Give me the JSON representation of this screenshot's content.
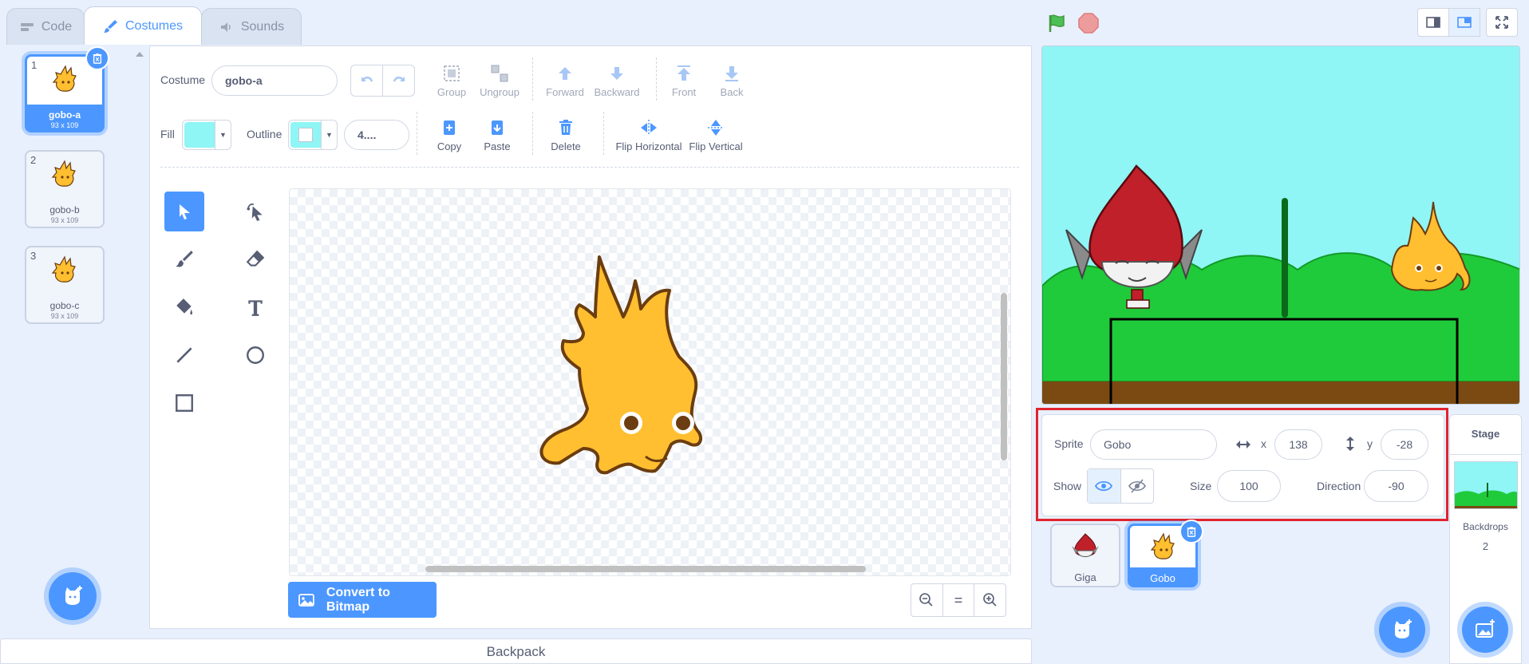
{
  "tabs": [
    {
      "label": "Code",
      "icon": "code-icon"
    },
    {
      "label": "Costumes",
      "icon": "brush-icon"
    },
    {
      "label": "Sounds",
      "icon": "speaker-icon"
    }
  ],
  "costumes": [
    {
      "num": "1",
      "name": "gobo-a",
      "size": "93 x 109",
      "selected": true
    },
    {
      "num": "2",
      "name": "gobo-b",
      "size": "93 x 109",
      "selected": false
    },
    {
      "num": "3",
      "name": "gobo-c",
      "size": "93 x 109",
      "selected": false
    }
  ],
  "editor": {
    "costume_label": "Costume",
    "costume_name": "gobo-a",
    "fill_label": "Fill",
    "outline_label": "Outline",
    "outline_width": "4....",
    "fill_color": "#8ff5f5",
    "buttons_row1": {
      "group": "Group",
      "ungroup": "Ungroup",
      "forward": "Forward",
      "backward": "Backward",
      "front": "Front",
      "back": "Back"
    },
    "buttons_row2": {
      "copy": "Copy",
      "paste": "Paste",
      "delete": "Delete",
      "flip_h": "Flip Horizontal",
      "flip_v": "Flip Vertical"
    },
    "convert_label": "Convert to Bitmap",
    "zoom_reset": "="
  },
  "backpack_label": "Backpack",
  "sprite_info": {
    "sprite_label": "Sprite",
    "sprite_name": "Gobo",
    "x_label": "x",
    "x_value": "138",
    "y_label": "y",
    "y_value": "-28",
    "show_label": "Show",
    "size_label": "Size",
    "size_value": "100",
    "direction_label": "Direction",
    "direction_value": "-90"
  },
  "sprites": [
    {
      "name": "Giga",
      "selected": false
    },
    {
      "name": "Gobo",
      "selected": true
    }
  ],
  "stage_pane": {
    "title": "Stage",
    "backdrops_label": "Backdrops",
    "backdrops_count": "2"
  },
  "colors": {
    "accent": "#4c97ff",
    "highlight": "#e0242f",
    "stage_sky": "#8ff5f5",
    "grass": "#1fcb3a",
    "ground": "#7a4a12"
  }
}
